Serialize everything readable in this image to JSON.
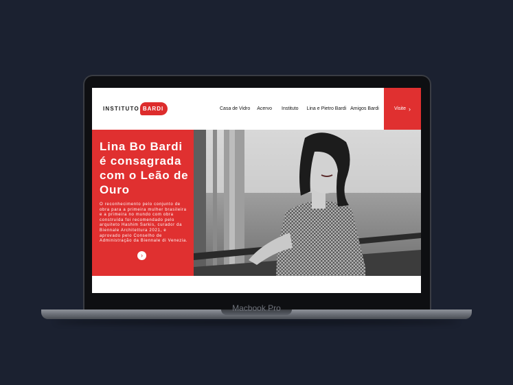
{
  "laptop": {
    "model_label": "Macbook Pro"
  },
  "logo": {
    "left_text": "INSTITUTO",
    "right_text": "BARDI"
  },
  "nav": {
    "items": [
      "Casa de Vidro",
      "Acervo",
      "Instituto",
      "Lina e Pietro Bardi",
      "Amigos Bardi"
    ],
    "visit_label": "Visite",
    "visit_icon": "chevron-right-icon"
  },
  "hero": {
    "title": "Lina Bo Bardi é consagrada com o Leão de Ouro",
    "body": "O reconhecimento pelo conjunto de obra para a primeira mulher brasileira e a primeira no mundo com obra construída foi recomendado pelo arquiteto Hashim Sarkis, curador da Biennale Architettura 2021, e aprovado pelo Conselho de Administração da Biennale di Venezia.",
    "arrow_icon": "chevron-right-icon"
  },
  "colors": {
    "accent": "#e03030",
    "background": "#1b2130"
  }
}
